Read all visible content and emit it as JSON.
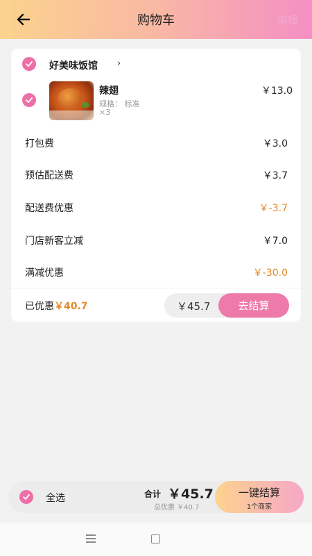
{
  "header": {
    "title": "购物车",
    "edit_label": "编辑"
  },
  "shop": {
    "name": "好美味饭馆",
    "chevron": "›"
  },
  "item": {
    "name": "辣翅",
    "spec": "规格：  标准",
    "qty": "×3",
    "price": "￥13.0"
  },
  "fees": [
    {
      "label": "打包费",
      "value": "￥3.0",
      "highlight": false
    },
    {
      "label": "预估配送费",
      "value": "￥3.7",
      "highlight": false
    },
    {
      "label": "配送费优惠",
      "value": "￥-3.7",
      "highlight": true
    },
    {
      "label": "门店新客立减",
      "value": "￥7.0",
      "highlight": false
    },
    {
      "label": "满减优惠",
      "value": "￥-30.0",
      "highlight": true
    }
  ],
  "summary": {
    "saved_label": "已优惠",
    "saved_amount": "￥40.7",
    "total": "￥45.7",
    "pay_label": "去结算"
  },
  "bottom": {
    "select_all": "全选",
    "sum_label": "合计",
    "sum_value": "￥45.7",
    "discount_text": "总优惠 ￥40.7",
    "checkout_label": "一键结算",
    "checkout_sub": "1个商家"
  },
  "colors": {
    "accent_pink": "#ee6fa8",
    "discount_orange": "#e28a28"
  },
  "icons": [
    "back-arrow-icon",
    "check-icon",
    "chevron-right-icon",
    "menu-icon",
    "home-icon"
  ]
}
